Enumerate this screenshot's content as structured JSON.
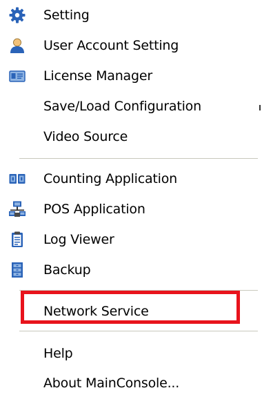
{
  "menu": {
    "items": [
      {
        "label": "Setting",
        "icon": "gear-icon"
      },
      {
        "label": "User Account Setting",
        "icon": "user-icon"
      },
      {
        "label": "License Manager",
        "icon": "license-card-icon"
      },
      {
        "label": "Save/Load Configuration",
        "icon": ""
      },
      {
        "label": "Video Source",
        "icon": ""
      },
      {
        "label": "Counting Application",
        "icon": "counting-icon"
      },
      {
        "label": "POS Application",
        "icon": "pos-network-icon"
      },
      {
        "label": "Log Viewer",
        "icon": "clipboard-icon"
      },
      {
        "label": "Backup",
        "icon": "backup-icon"
      },
      {
        "label": "Network Service",
        "icon": ""
      },
      {
        "label": "Help",
        "icon": ""
      },
      {
        "label": "About MainConsole...",
        "icon": ""
      }
    ]
  },
  "highlight": {
    "target": "Network Service",
    "color": "#e8131c"
  },
  "colors": {
    "icon_blue": "#2a63b8",
    "icon_light_blue": "#8fb4e3",
    "separator": "#c8c8bc"
  }
}
